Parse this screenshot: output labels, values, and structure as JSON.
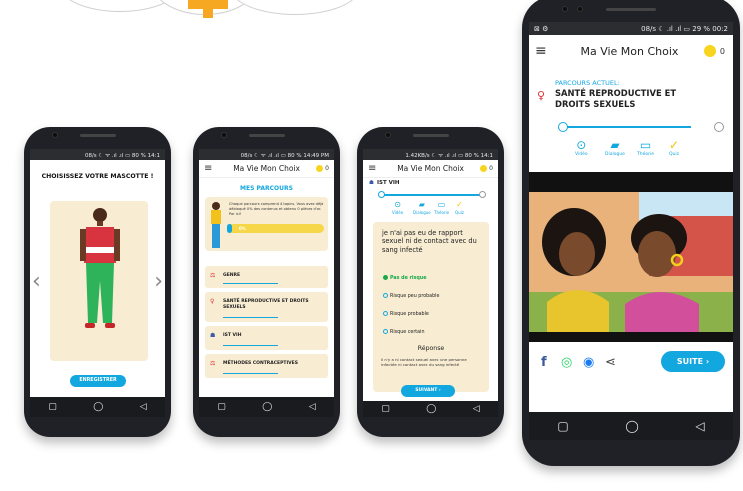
{
  "status_bars": {
    "phone1": "08/s ☾ ᯤ .ıl .ıl ▭ 80 % 14:1",
    "phone2": "08/s ☾ ᯤ .ıl .ıl ▭ 80 % 14:49 PM",
    "phone3": "1.42KB/s ☾ ᯤ .ıl .ıl ▭ 80 % 14:1",
    "phone4": "08/s ☾ .ıl .ıl ▭ 29 % 00:2"
  },
  "app": {
    "title": "Ma Vie Mon Choix",
    "coins": "0",
    "menu_glyph": "≡"
  },
  "mascot_screen": {
    "title": "CHOISISSEZ VOTRE MASCOTTE !",
    "prev": "‹",
    "next": "›",
    "button": "ENREGISTRER"
  },
  "parcours_screen": {
    "title": "MES PARCOURS",
    "intro": "Chaque parcours comprend 4 topics. Vous avez déjà débloqué 0% des contenus et obtenu 0 pièces d'or. Par ici!",
    "progress": "0%",
    "progress_fraction": 0.05,
    "items": [
      {
        "label": "GENRE",
        "icon": "⚖"
      },
      {
        "label": "SANTÉ REPRODUCTIVE ET DROITS SEXUELS",
        "icon": "♀"
      },
      {
        "label": "IST VIH",
        "icon": "☗"
      },
      {
        "label": "MÉTHODES CONTRACEPTIVES",
        "icon": "⚖"
      }
    ]
  },
  "quiz_screen": {
    "topic": "IST VIH",
    "tabs": [
      "Vidéo",
      "Dialogue",
      "Théorie",
      "Quiz"
    ],
    "question": "je n'ai pas eu de rapport sexuel ni de contact avec du sang infecté",
    "options": [
      "Pas de risque",
      "Risque peu probable",
      "Risque probable",
      "Risque certain"
    ],
    "selected": 0,
    "answer_title": "Réponse",
    "answer_text": "il n'y a ni contact sexuel avec une personne infectée ni contact avec du sang infecté",
    "button": "SUIVANT ›"
  },
  "video_screen": {
    "label": "PARCOURS ACTUEL:",
    "topic": "SANTÉ REPRODUCTIVE ET DROITS SEXUELS",
    "tabs": [
      "Vidéo",
      "Dialogue",
      "Théorie",
      "Quiz"
    ],
    "share": [
      "f",
      "◎",
      "◉",
      "⋖"
    ],
    "button": "SUITE ›"
  },
  "nav": {
    "recent": "▢",
    "home": "◯",
    "back": "◁"
  },
  "colors": {
    "accent": "#12a7df",
    "card": "#f8ecd2",
    "coin": "#f7d41e",
    "quiz_check": "#f5c400"
  }
}
